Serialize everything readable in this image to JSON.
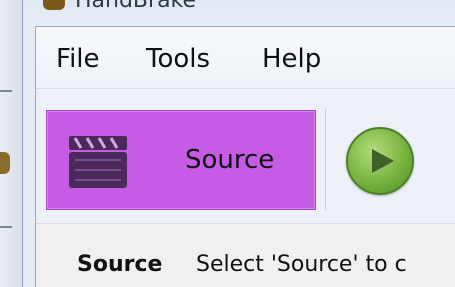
{
  "window": {
    "title": "HandBrake"
  },
  "menu": {
    "items": [
      {
        "label": "File"
      },
      {
        "label": "Tools"
      },
      {
        "label": "Help"
      }
    ]
  },
  "toolbar": {
    "source_button": {
      "label": "Source",
      "icon": "clapperboard-icon",
      "background": "#c65be6"
    },
    "start_button": {
      "icon": "play-icon",
      "color": "#78b33f"
    }
  },
  "status": {
    "label": "Source",
    "text": "Select 'Source' to c"
  }
}
